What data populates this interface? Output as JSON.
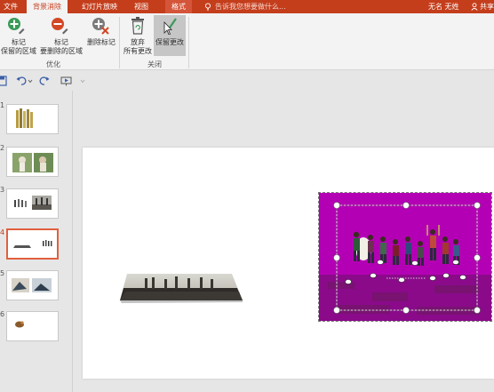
{
  "tabs": {
    "file": "文件",
    "background_removal": "背景消除",
    "slideshow": "幻灯片放映",
    "view": "视图",
    "format": "格式"
  },
  "tell_me": "告诉我您想要做什么...",
  "user": "无名 无姓",
  "share": "共享",
  "ribbon": {
    "mark_keep": "标记\n保留的区域",
    "mark_remove": "标记\n要删除的区域",
    "delete_mark": "删除标记",
    "group_optimize": "优化",
    "discard": "放弃\n所有更改",
    "keep_changes": "保留更改",
    "group_close": "关闭"
  },
  "slide_numbers": [
    "1",
    "2",
    "3",
    "4",
    "5",
    "6"
  ],
  "colors": {
    "accent": "#c43e1c",
    "removal_mask": "#b400b4",
    "selection_border": "#e0603f"
  }
}
